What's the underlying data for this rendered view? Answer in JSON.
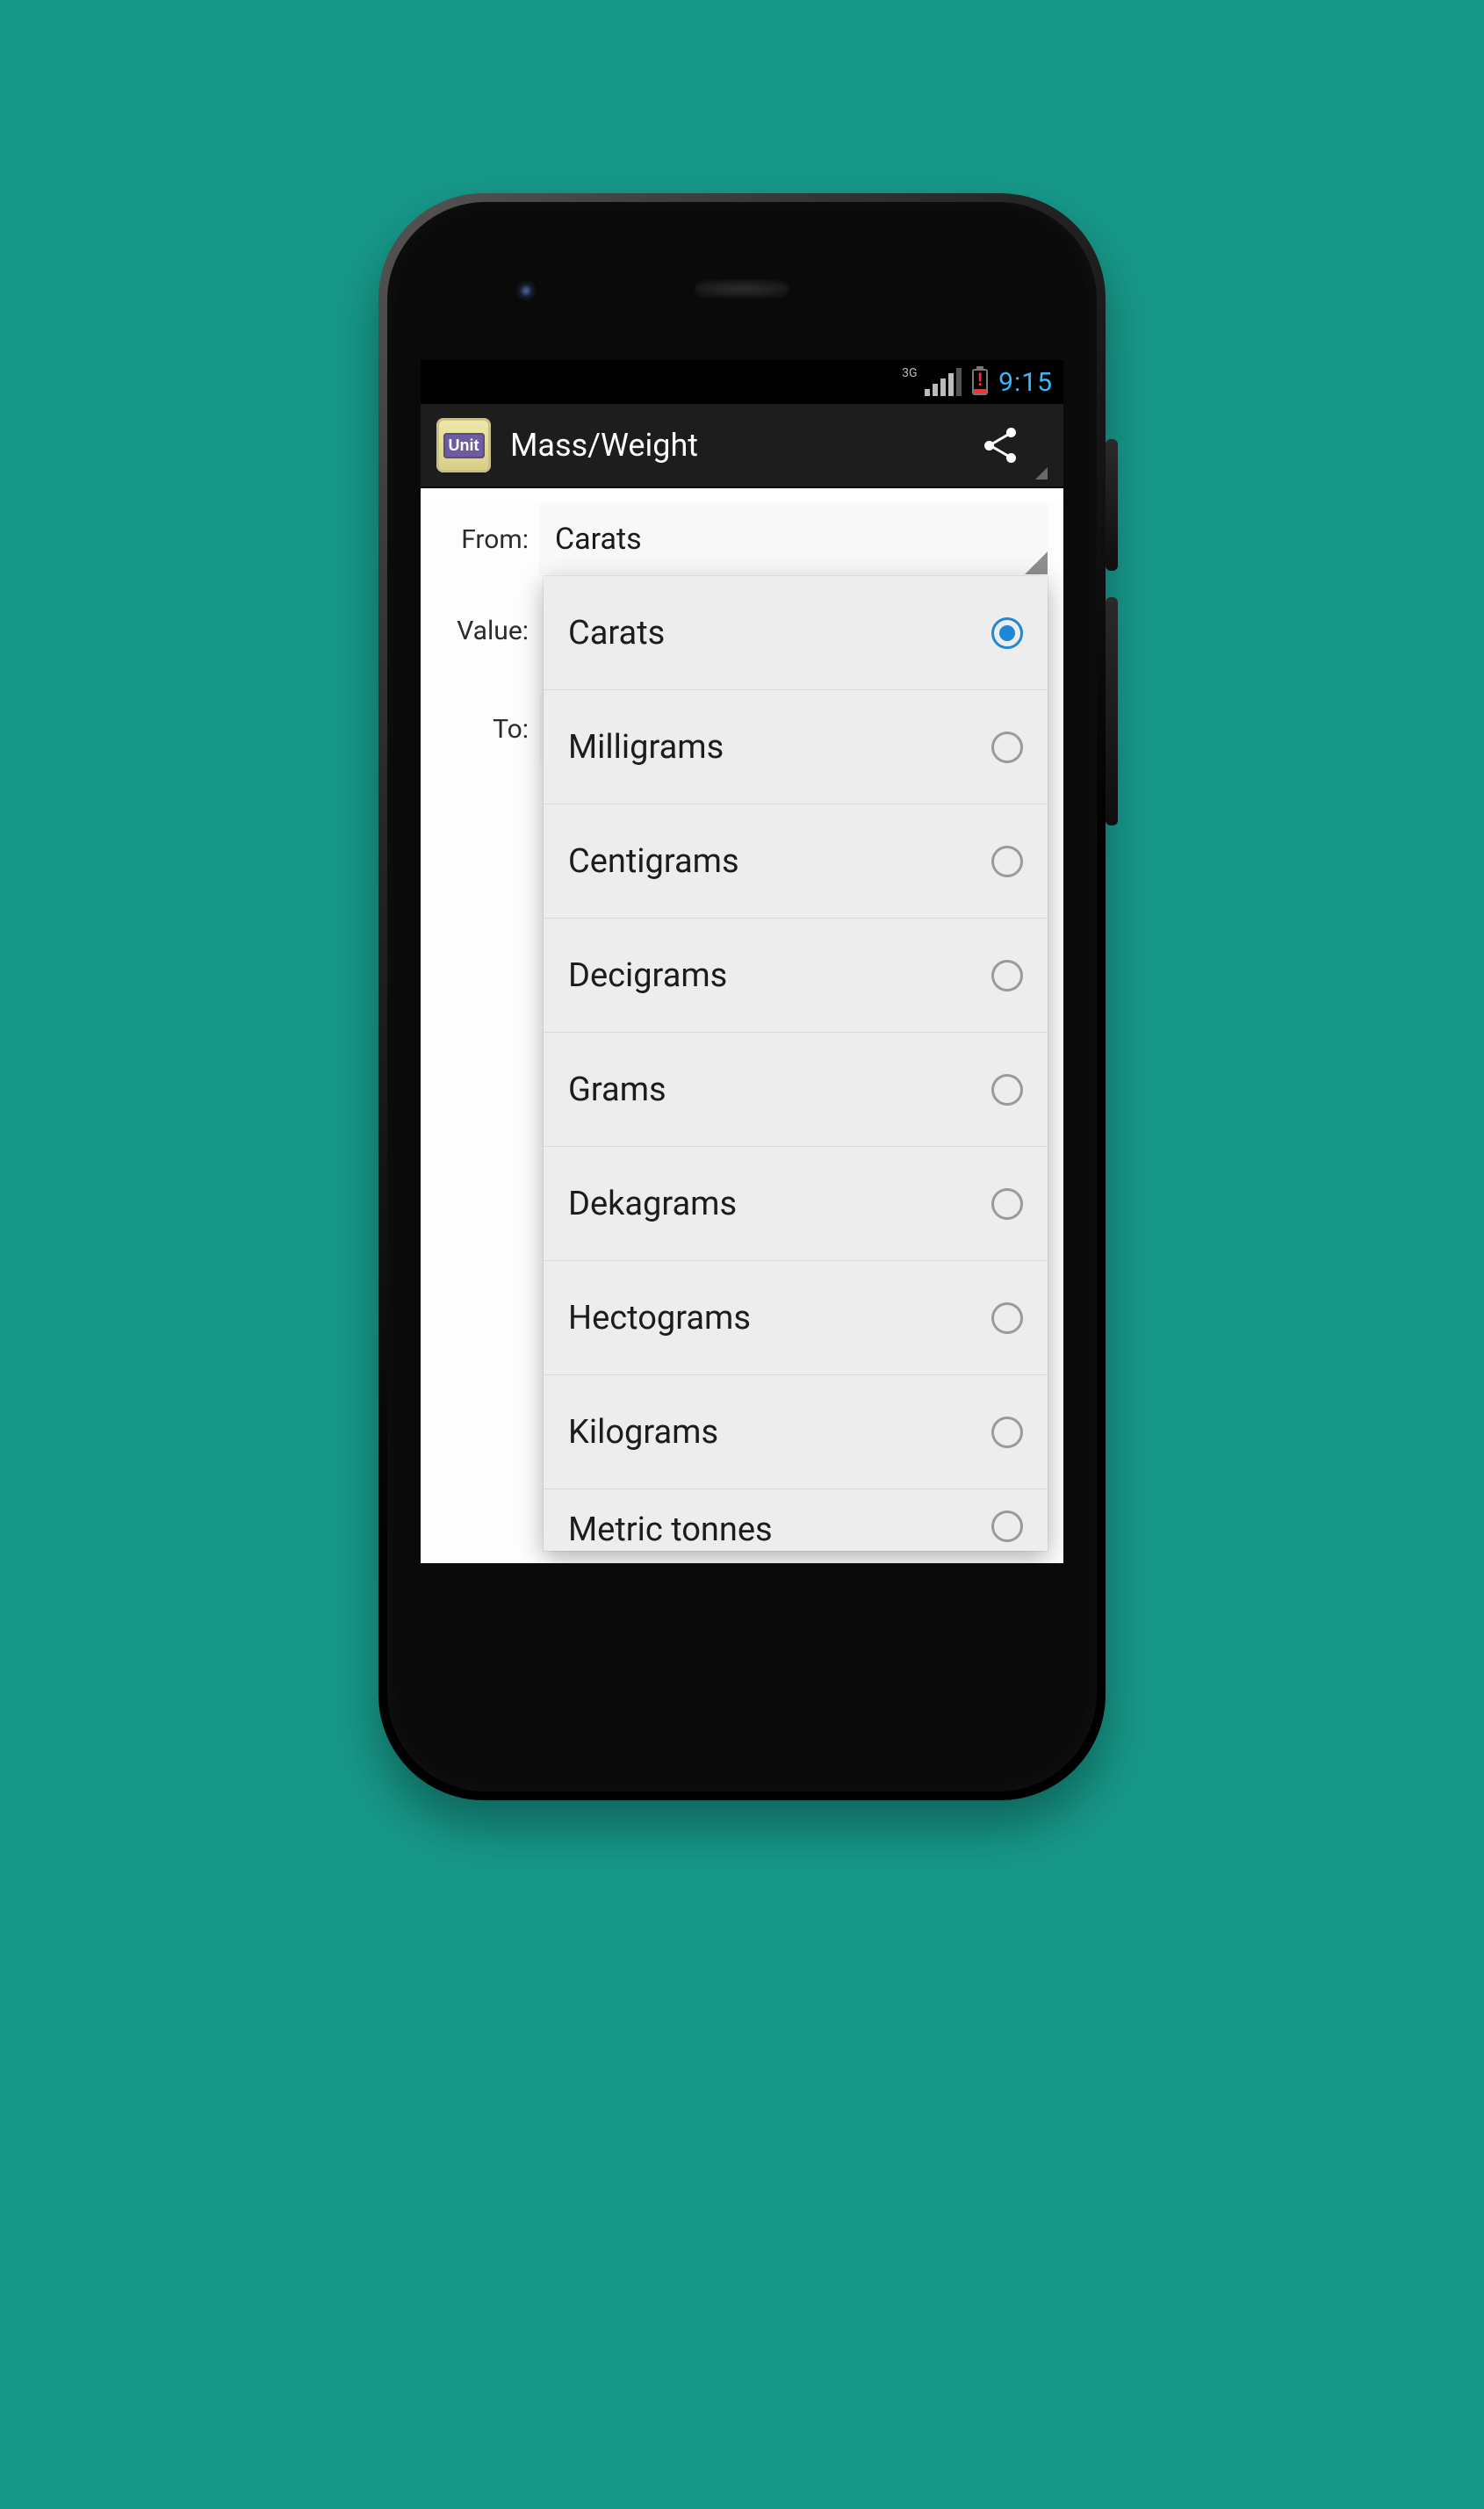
{
  "status": {
    "network_label": "3G",
    "clock": "9:15"
  },
  "actionbar": {
    "app_icon_text": "Unit",
    "title": "Mass/Weight"
  },
  "form": {
    "from_label": "From:",
    "from_value": "Carats",
    "value_label": "Value:",
    "value_value": "",
    "to_label": "To:",
    "to_value": ""
  },
  "popup": {
    "options": [
      {
        "label": "Carats",
        "selected": true
      },
      {
        "label": "Milligrams",
        "selected": false
      },
      {
        "label": "Centigrams",
        "selected": false
      },
      {
        "label": "Decigrams",
        "selected": false
      },
      {
        "label": "Grams",
        "selected": false
      },
      {
        "label": "Dekagrams",
        "selected": false
      },
      {
        "label": "Hectograms",
        "selected": false
      },
      {
        "label": "Kilograms",
        "selected": false
      },
      {
        "label": "Metric tonnes",
        "selected": false
      }
    ]
  }
}
